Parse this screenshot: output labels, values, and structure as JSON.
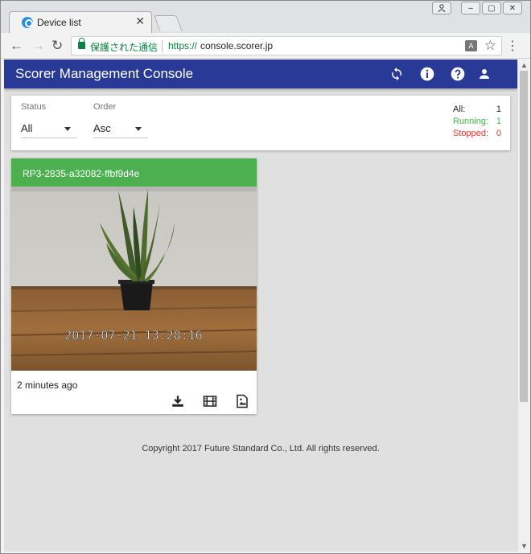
{
  "browser": {
    "tab": {
      "title": "Device list",
      "close": "✕"
    },
    "window_buttons": {
      "user": "⍝",
      "minimize": "–",
      "maximize": "▢",
      "close": "✕"
    },
    "nav": {
      "back": "←",
      "forward": "→",
      "reload": "↻"
    },
    "omnibox": {
      "secure_text": "保護された通信",
      "url_scheme": "https://",
      "url_host": "console.scorer.jp"
    },
    "translate": "A",
    "star": "☆",
    "menu": "⋮",
    "scroll_up": "▲",
    "scroll_down": "▼"
  },
  "app": {
    "title": "Scorer Management Console",
    "header_icons": [
      "refresh-icon",
      "info-icon",
      "help-icon",
      "account-icon"
    ],
    "colors": {
      "header": "#293a96",
      "running": "#4caf50",
      "stopped": "#e53935"
    }
  },
  "filters": {
    "status": {
      "label": "Status",
      "value": "All"
    },
    "order": {
      "label": "Order",
      "value": "Asc"
    }
  },
  "stats": {
    "all": {
      "label": "All:",
      "value": "1"
    },
    "running": {
      "label": "Running:",
      "value": "1"
    },
    "stopped": {
      "label": "Stopped:",
      "value": "0"
    }
  },
  "device": {
    "id": "RP3-2835-a32082-ffbf9d4e",
    "status_color": "#4caf50",
    "image_timestamp": "2017-07-21 13:28:16",
    "time_ago": "2 minutes ago",
    "actions": [
      "download-icon",
      "video-icon",
      "image-icon"
    ]
  },
  "footer": {
    "copyright": "Copyright 2017 Future Standard Co., Ltd. All rights reserved."
  }
}
